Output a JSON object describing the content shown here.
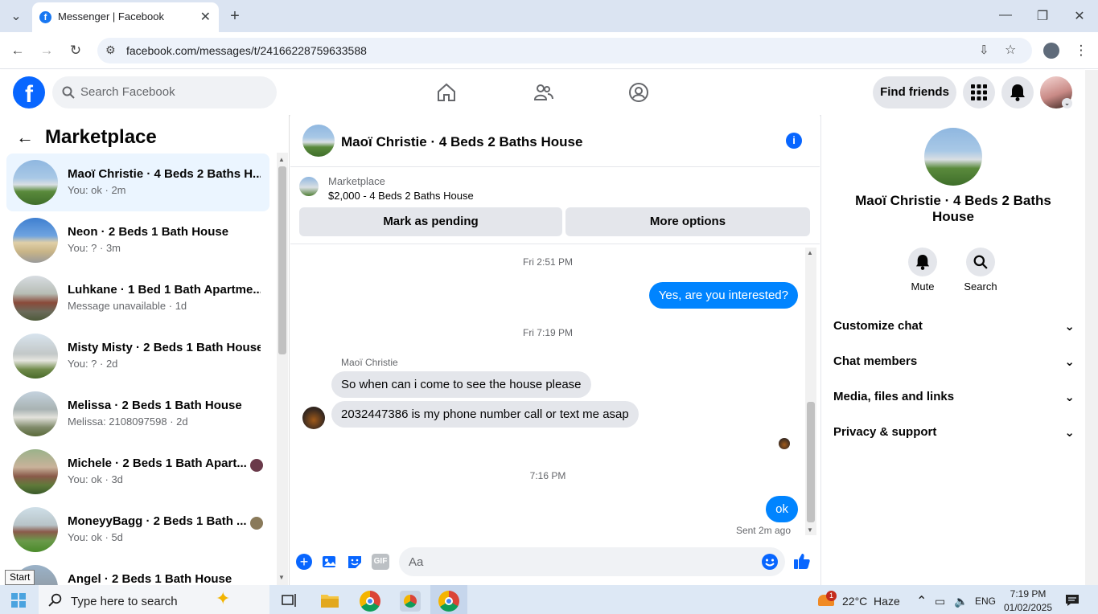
{
  "browser": {
    "tab_title": "Messenger | Facebook",
    "url": "facebook.com/messages/t/24166228759633588"
  },
  "fb_header": {
    "logo": "f",
    "search_placeholder": "Search Facebook",
    "find_friends": "Find friends"
  },
  "left": {
    "title": "Marketplace",
    "conversations": [
      {
        "name": "Maoï Christie · 4 Beds 2 Baths H...",
        "sub": "You: ok · 2m",
        "active": true
      },
      {
        "name": "Neon · 2 Beds 1 Bath House",
        "sub": "You: ? · 3m"
      },
      {
        "name": "Luhkane · 1 Bed 1 Bath Apartme...",
        "sub": "Message unavailable · 1d"
      },
      {
        "name": "Misty Misty · 2 Beds 1 Bath House",
        "sub": "You: ? · 2d"
      },
      {
        "name": "Melissa · 2 Beds 1 Bath House",
        "sub": "Melissa: 2108097598 · 2d"
      },
      {
        "name": "Michele · 2 Beds 1 Bath Apart...",
        "sub": "You: ok · 3d"
      },
      {
        "name": "MoneyyBagg · 2 Beds 1 Bath ...",
        "sub": "You: ok · 5d"
      },
      {
        "name": "Angel · 2 Beds 1 Bath House",
        "sub": ""
      }
    ]
  },
  "chat": {
    "title": "Maoï Christie · 4 Beds 2 Baths House",
    "marketplace_label": "Marketplace",
    "listing": "$2,000 - 4 Beds 2 Baths House",
    "mark_pending": "Mark as pending",
    "more_options": "More options",
    "time1": "Fri 2:51 PM",
    "msg_out1": "Yes, are you interested?",
    "time2": "Fri 7:19 PM",
    "sender": "Maoï Christie",
    "msg_in1": "So when can i come to see the house please",
    "msg_in2": "2032447386 is my phone number call or text me asap",
    "time3": "7:16 PM",
    "msg_out2": "ok",
    "sent_status": "Sent 2m ago",
    "composer_placeholder": "Aa"
  },
  "right": {
    "name": "Maoï Christie · 4 Beds 2 Baths House",
    "mute": "Mute",
    "search": "Search",
    "items": [
      "Customize chat",
      "Chat members",
      "Media, files and links",
      "Privacy & support"
    ]
  },
  "taskbar": {
    "start_tooltip": "Start",
    "search_placeholder": "Type here to search",
    "weather_badge": "1",
    "weather": "22°C  Haze",
    "lang": "ENG",
    "time": "7:19 PM",
    "date": "01/02/2025"
  },
  "colors": {
    "fb_blue": "#0866ff",
    "bubble_blue": "#0084ff",
    "active_row": "#ebf5ff"
  }
}
